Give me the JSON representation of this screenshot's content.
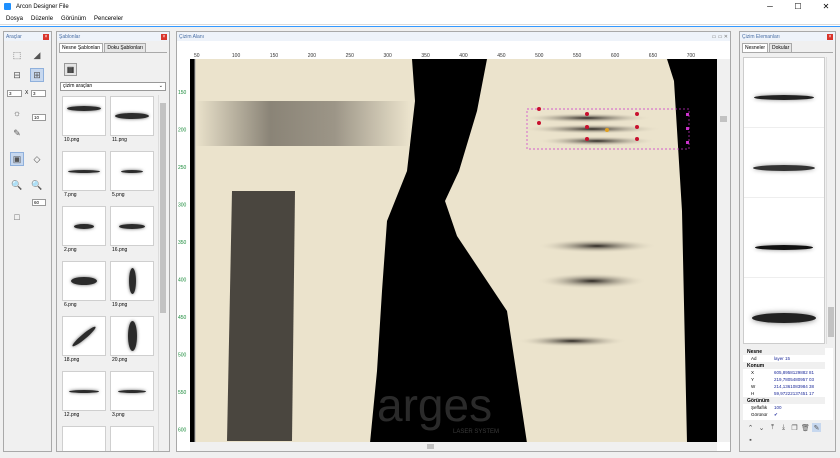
{
  "app": {
    "title": "Arcon Designer File"
  },
  "window_controls": {
    "minimize": "─",
    "maximize": "☐",
    "close": "✕"
  },
  "menu": [
    "Dosya",
    "Düzenle",
    "Görünüm",
    "Pencereler"
  ],
  "tools_panel": {
    "title": "Araçlar",
    "spin_cols": "3",
    "spin_rows": "3",
    "x_label": "X",
    "spin_small": "10",
    "spin_zoom": "60"
  },
  "templates_panel": {
    "title": "Şablonlar",
    "tabs": [
      "Nesne Şablonları",
      "Doku Şablonları"
    ],
    "dropdown": "çizim araçları",
    "items": [
      {
        "label": "10.png",
        "shape": "wide-top"
      },
      {
        "label": "11.png",
        "shape": "wide"
      },
      {
        "label": "7.png",
        "shape": "thin"
      },
      {
        "label": "5.png",
        "shape": "thin-short"
      },
      {
        "label": "2.png",
        "shape": "small"
      },
      {
        "label": "16.png",
        "shape": "small-wide"
      },
      {
        "label": "6.png",
        "shape": "ellipse"
      },
      {
        "label": "19.png",
        "shape": "vertical"
      },
      {
        "label": "18.png",
        "shape": "diagonal"
      },
      {
        "label": "20.png",
        "shape": "vertical-big"
      },
      {
        "label": "12.png",
        "shape": "line"
      },
      {
        "label": "3.png",
        "shape": "line-short"
      }
    ]
  },
  "canvas": {
    "title": "Çizim Alanı",
    "ruler_top": [
      "50",
      "100",
      "150",
      "200",
      "250",
      "300",
      "350",
      "400",
      "450",
      "500",
      "550",
      "600",
      "650",
      "700"
    ],
    "ruler_left": [
      "150",
      "200",
      "250",
      "300",
      "350",
      "400",
      "450",
      "500",
      "550",
      "600"
    ],
    "watermark": "arges",
    "watermark_sub": "LASER SYSTEM"
  },
  "elements_panel": {
    "title": "Çizim Elemanları",
    "tabs": [
      "Nesneler",
      "Dokular"
    ],
    "groups": {
      "object": "Nesne",
      "name_key": "Ad",
      "name_val": "layer 15",
      "position": "Konum",
      "x_key": "X",
      "x_val": "605,8958129882 81",
      "y_key": "Y",
      "y_val": "219,7805480957 03",
      "w_key": "W",
      "w_val": "214,1361083984 38",
      "h_key": "H",
      "h_val": "59,97222137451 17",
      "view": "Görünüm",
      "opacity_key": "Şeffaflık",
      "opacity_val": "100",
      "visible_key": "Görünür",
      "visible_val": "✔"
    }
  },
  "colors": {
    "accent": "#3399ff",
    "canvas_bg": "#000000",
    "fabric": "#ebe3cc",
    "handle": "#cc33cc",
    "point": "#c8102e"
  }
}
